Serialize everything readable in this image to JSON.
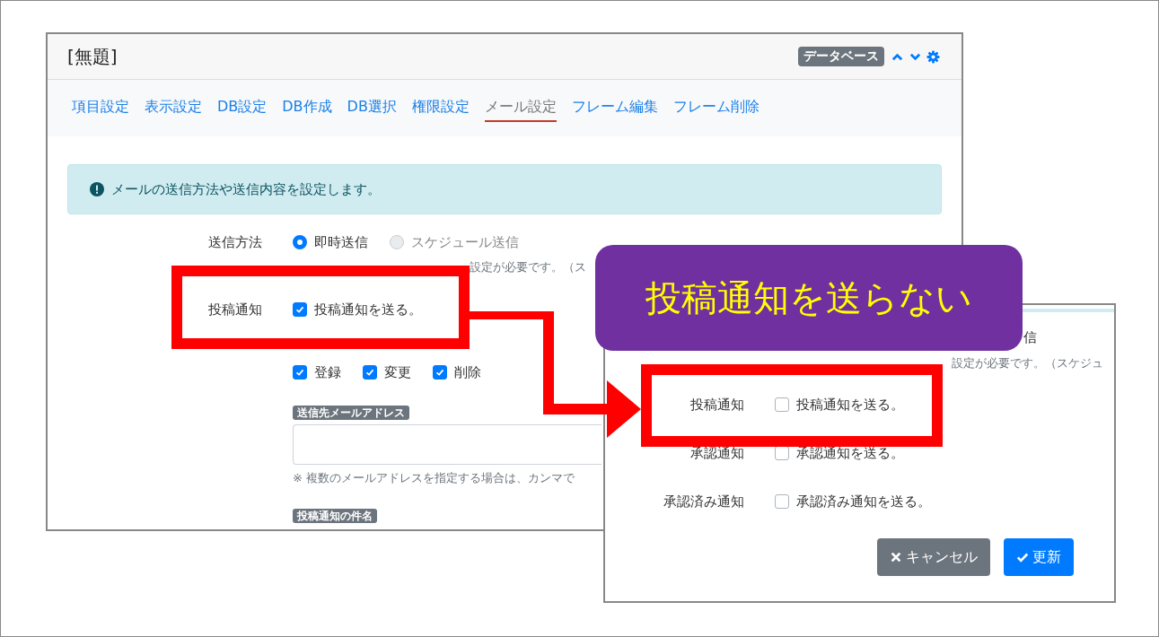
{
  "panel": {
    "title": "[無題]",
    "badge": "データベース",
    "tabs": [
      {
        "label": "項目設定",
        "selected": false
      },
      {
        "label": "表示設定",
        "selected": false
      },
      {
        "label": "DB設定",
        "selected": false
      },
      {
        "label": "DB作成",
        "selected": false
      },
      {
        "label": "DB選択",
        "selected": false
      },
      {
        "label": "権限設定",
        "selected": false
      },
      {
        "label": "メール設定",
        "selected": true
      },
      {
        "label": "フレーム編集",
        "selected": false
      },
      {
        "label": "フレーム削除",
        "selected": false
      }
    ],
    "alert": "メールの送信方法や送信内容を設定します。",
    "send_method": {
      "label": "送信方法",
      "options": [
        {
          "label": "即時送信",
          "selected": true,
          "disabled": false
        },
        {
          "label": "スケジュール送信",
          "selected": false,
          "disabled": true
        }
      ],
      "note": "設定が必要です。（ス"
    },
    "post_notice": {
      "label": "投稿通知",
      "text": "投稿通知を送る。",
      "checked": true
    },
    "timing": [
      {
        "label": "登録",
        "checked": true
      },
      {
        "label": "変更",
        "checked": true
      },
      {
        "label": "削除",
        "checked": true
      }
    ],
    "address": {
      "label": "送信先メールアドレス",
      "note": "※ 複数のメールアドレスを指定する場合は、カンマで"
    },
    "subject_label": "投稿通知の件名"
  },
  "callout": "投稿通知を送らない",
  "dialog": {
    "fragment": "信",
    "note": "設定が必要です。（スケジュ",
    "rows": [
      {
        "label": "投稿通知",
        "text": "投稿通知を送る。",
        "checked": false
      },
      {
        "label": "承認通知",
        "text": "承認通知を送る。",
        "checked": false
      },
      {
        "label": "承認済み通知",
        "text": "承認済み通知を送る。",
        "checked": false
      }
    ],
    "buttons": [
      {
        "label": "キャンセル",
        "kind": "cancel"
      },
      {
        "label": "更新",
        "kind": "submit"
      }
    ]
  }
}
